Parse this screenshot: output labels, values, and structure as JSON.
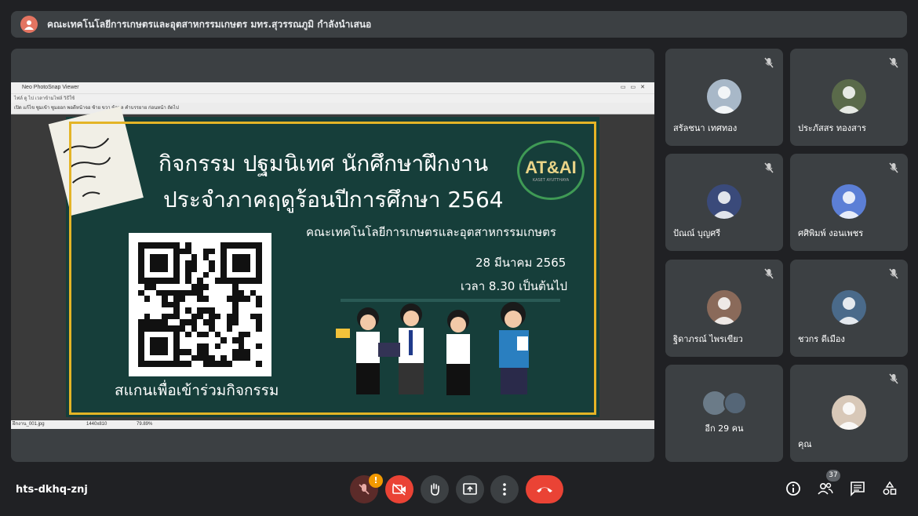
{
  "banner": {
    "text": "คณะเทคโนโลยีการเกษตรและอุตสาหกรรมเกษตร มทร.สุวรรณภูมิ กำลังนำเสนอ"
  },
  "viewer": {
    "title": "Neo PhotoSnap Viewer",
    "menu": "ไฟล์   ดู   ไป   เวลาข้ามไฟล์   วิธีใช้",
    "toolbar": "เปิด  แก้ไข  ซูมเข้า  ซูมออก  พอดีหน้าจอ  ซ้าย  ขวา  ข้อมูล  คำบรรยาย  ก่อนหน้า  ถัดไป",
    "status_file": "ฝึกงาน_001.jpg",
    "status_size": "1440x810",
    "status_zoom": "79.89%"
  },
  "poster": {
    "line1": "กิจกรรม ปฐมนิเทศ นักศึกษาฝึกงาน",
    "line2": "ประจำภาคฤดูร้อนปีการศึกษา 2564",
    "faculty": "คณะเทคโนโลยีการเกษตรและอุตสาหกรรมเกษตร",
    "date": "28 มีนาคม 2565",
    "time": "เวลา 8.30 เป็นต้นไป",
    "scan": "สแกนเพื่อเข้าร่วมกิจกรรม",
    "logo_text": "AT&AI",
    "logo_sub": "KASET AYUTTHAYA"
  },
  "participants": [
    {
      "name": "สรัลชนา เทศทอง",
      "color": "#a8b8c8"
    },
    {
      "name": "ประภัสสร ทองสาร",
      "color": "#5a6a4a"
    },
    {
      "name": "ปัณณ์ บุญศรี",
      "color": "#3a4a7a"
    },
    {
      "name": "ศศิพิมพ์ งอนเพชร",
      "color": "#5c7fd6"
    },
    {
      "name": "ฐิดาภรณ์ ไพรเขียว",
      "color": "#8a6a5a"
    },
    {
      "name": "ชวกร ดีเมือง",
      "color": "#4a6a8a"
    },
    {
      "name": "อีก 29 คน",
      "color": "#667"
    },
    {
      "name": "คุณ",
      "color": "#d8c8b8"
    }
  ],
  "meeting": {
    "code": "hts-dkhq-znj",
    "people_count": "37",
    "warning": "!"
  },
  "colors": {
    "bg": "#202124",
    "tile": "#3c4043",
    "danger": "#ea4335",
    "poster": "#163e3a",
    "frame": "#e4b426"
  }
}
